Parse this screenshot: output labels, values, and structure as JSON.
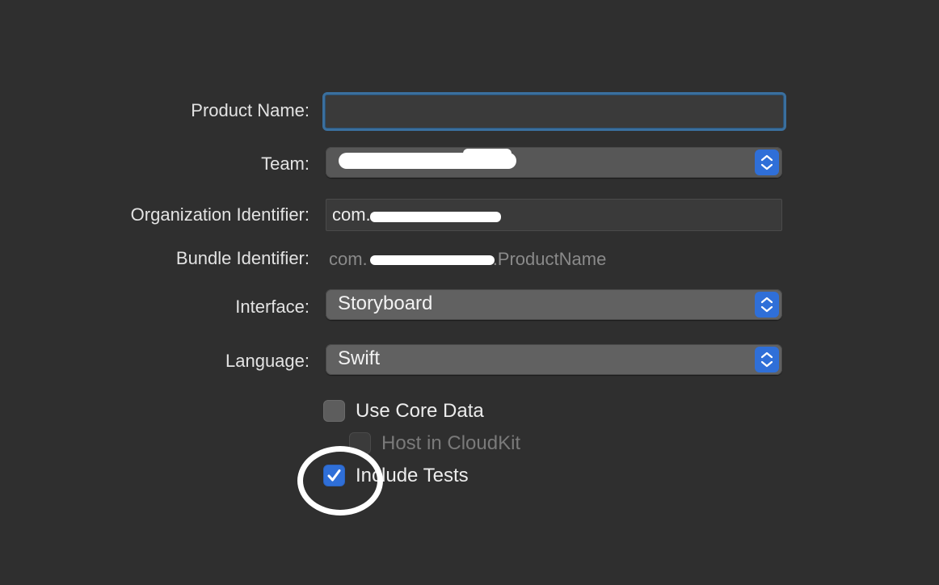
{
  "form": {
    "product_name": {
      "label": "Product Name:",
      "value": ""
    },
    "team": {
      "label": "Team:",
      "value": ""
    },
    "organization_identifier": {
      "label": "Organization Identifier:",
      "value": "com."
    },
    "bundle_identifier": {
      "label": "Bundle Identifier:",
      "prefix": "com.",
      "suffix": ".ProductName"
    },
    "interface": {
      "label": "Interface:",
      "value": "Storyboard"
    },
    "language": {
      "label": "Language:",
      "value": "Swift"
    }
  },
  "options": {
    "use_core_data": {
      "label": "Use Core Data",
      "checked": false
    },
    "host_in_cloudkit": {
      "label": "Host in CloudKit",
      "checked": false,
      "enabled": false
    },
    "include_tests": {
      "label": "Include Tests",
      "checked": true
    }
  },
  "colors": {
    "background": "#2f2f2f",
    "accent": "#2f6fd8",
    "focus_ring": "#3a6f9e",
    "annotation": "#ffffff"
  },
  "icons": {
    "popup_stepper": "up-down-chevron-icon",
    "checkmark": "checkmark-icon"
  }
}
